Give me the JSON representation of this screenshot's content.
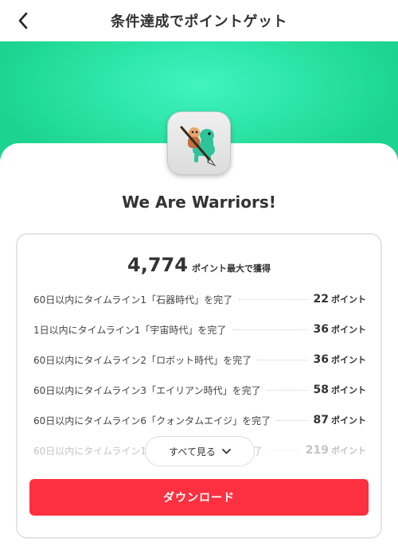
{
  "header": {
    "title": "条件達成でポイントゲット"
  },
  "app": {
    "name": "We Are Warriors!"
  },
  "rewards": {
    "total": "4,774",
    "total_label": "ポイント最大で獲得",
    "unit": "ポイント",
    "tasks": [
      {
        "text": "60日以内にタイムライン1「石器時代」を完了",
        "points": "22"
      },
      {
        "text": "1日以内にタイムライン1「宇宙時代」を完了",
        "points": "36"
      },
      {
        "text": "60日以内にタイムライン2「ロボット時代」を完了",
        "points": "36"
      },
      {
        "text": "60日以内にタイムライン3「エイリアン時代」を完了",
        "points": "58"
      },
      {
        "text": "60日以内にタイムライン6「クォンタムエイジ」を完了",
        "points": "87"
      },
      {
        "text": "60日以内にタイムライン1",
        "tail": "了",
        "points": "219"
      }
    ],
    "see_all_label": "すべて見る"
  },
  "download": {
    "label": "ダウンロード"
  },
  "colors": {
    "accent": "#fc3040",
    "hero": "#2fe6aa"
  },
  "icons": {
    "back": "chevron-left-icon",
    "see_all": "chevron-down-icon"
  }
}
